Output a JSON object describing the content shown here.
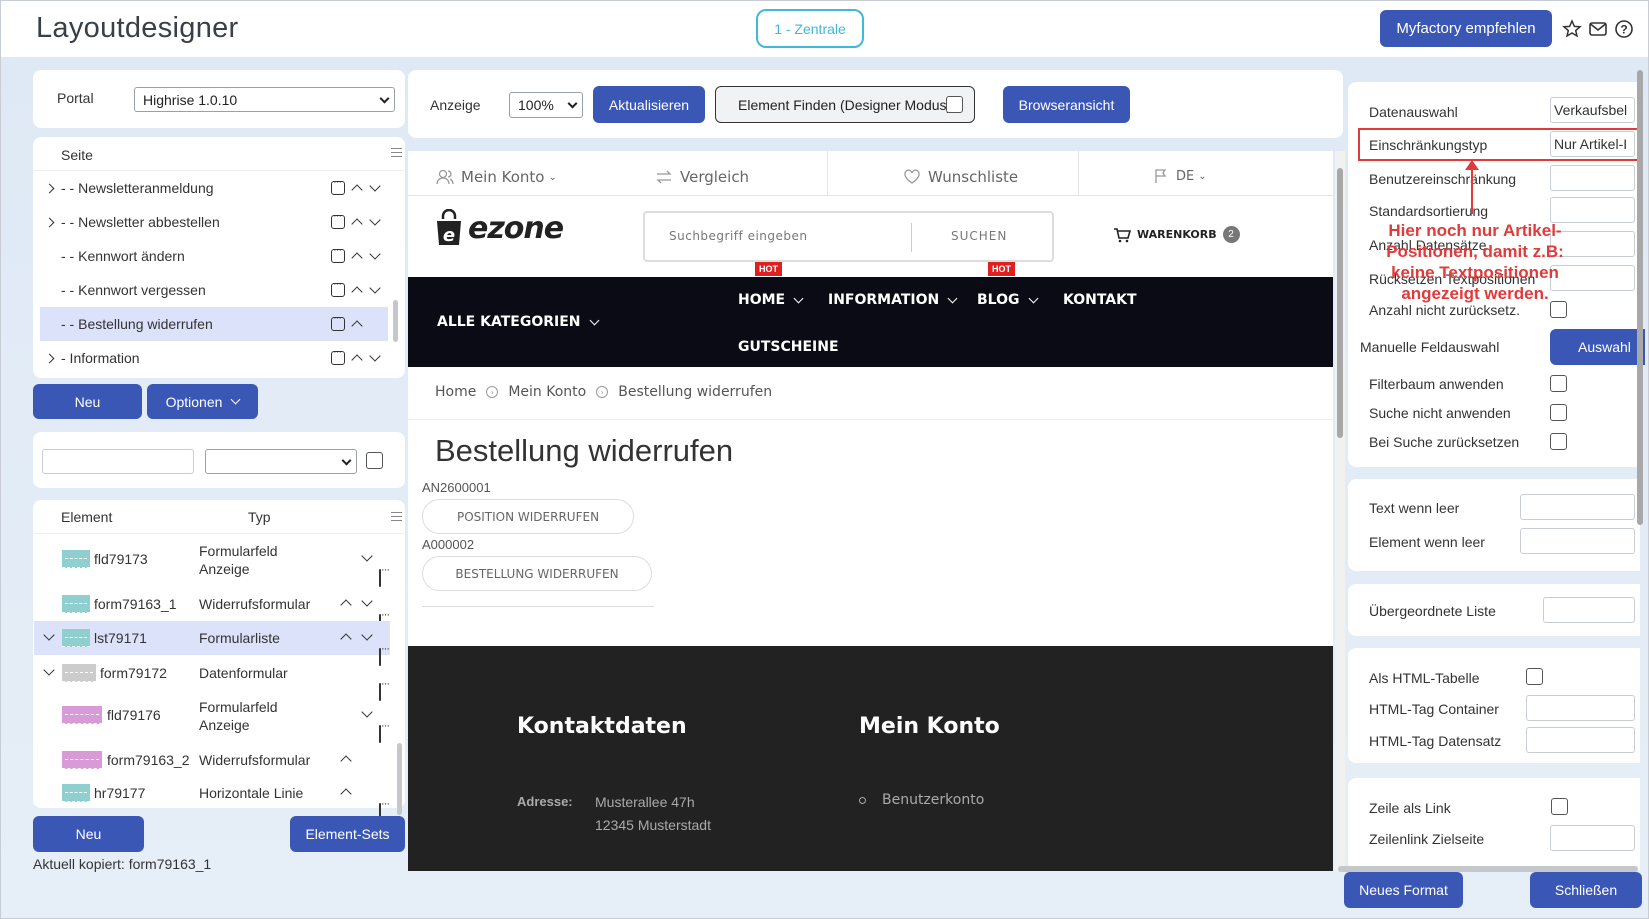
{
  "app": {
    "title": "Layoutdesigner",
    "location": "1 - Zentrale",
    "recommend_label": "Myfactory empfehlen"
  },
  "left": {
    "portal_label": "Portal",
    "portal_value": "Highrise 1.0.10",
    "page_header": "Seite",
    "pages": [
      {
        "label": "- - Newsletteranmeldung"
      },
      {
        "label": "- - Newsletter abbestellen"
      },
      {
        "label": "- - Kennwort ändern"
      },
      {
        "label": "- - Kennwort vergessen"
      },
      {
        "label": "- - Bestellung widerrufen"
      },
      {
        "label": "- Information"
      }
    ],
    "btn_new": "Neu",
    "btn_options": "Optionen",
    "element_header": "Element",
    "type_header": "Typ",
    "elements": [
      {
        "name": "fld79173",
        "type": "Formularfeld Anzeige",
        "color": "#8fcfcf"
      },
      {
        "name": "form79163_1",
        "type": "Widerrufsformular",
        "color": "#8fcfcf"
      },
      {
        "name": "lst79171",
        "type": "Formularliste",
        "color": "#8fcfcf"
      },
      {
        "name": "form79172",
        "type": "Datenformular",
        "color": "#cccccc"
      },
      {
        "name": "fld79176",
        "type": "Formularfeld Anzeige",
        "color": "#d89bd8"
      },
      {
        "name": "form79163_2",
        "type": "Widerrufsformular",
        "color": "#d89bd8"
      },
      {
        "name": "hr79177",
        "type": "Horizontale Linie",
        "color": "#8fcfcf"
      }
    ],
    "btn_new2": "Neu",
    "btn_sets": "Element-Sets",
    "copied": "Aktuell kopiert: form79163_1"
  },
  "toolbar": {
    "display_label": "Anzeige",
    "zoom": "100%",
    "refresh": "Aktualisieren",
    "find": "Element Finden (Designer Modus)",
    "browser": "Browseransicht"
  },
  "shop": {
    "account": "Mein Konto",
    "compare": "Vergleich",
    "wishlist": "Wunschliste",
    "lang": "DE",
    "logo": "ezone",
    "search_placeholder": "Suchbegriff eingeben",
    "search_btn": "SUCHEN",
    "cart": "WARENKORB",
    "cart_count": "2",
    "all_categories": "ALLE KATEGORIEN",
    "nav": [
      "HOME",
      "INFORMATION",
      "BLOG",
      "KONTAKT"
    ],
    "nav2": "GUTSCHEINE",
    "hot": "HOT",
    "breadcrumb": [
      "Home",
      "Mein Konto",
      "Bestellung widerrufen"
    ],
    "page_title": "Bestellung widerrufen",
    "id1": "AN2600001",
    "btn1": "POSITION WIDERRUFEN",
    "id2": "A000002",
    "btn2": "BESTELLUNG WIDERRUFEN",
    "footer_contact": "Kontaktdaten",
    "footer_account": "Mein Konto",
    "address_label": "Adresse:",
    "address_line1": "Musterallee 47h",
    "address_line2": "12345 Musterstadt",
    "footer_link": "Benutzerkonto"
  },
  "right": {
    "datenauswahl": "Datenauswahl",
    "datenauswahl_value": "Verkaufsbel",
    "einschraenkungstyp": "Einschränkungstyp",
    "einschraenkungstyp_value": "Nur Artikel-I",
    "benutzereinschraenkung": "Benutzereinschränkung",
    "standardsortierung": "Standardsortierung",
    "anzahl_datensaetze": "Anzahl Datensätze",
    "ruecksetzen": "Rücksetzen Textpositionen",
    "anzahl_nicht": "Anzahl nicht zurücksetz.",
    "manuelle": "Manuelle Feldauswahl",
    "auswahl_btn": "Auswahl",
    "filterbaum": "Filterbaum anwenden",
    "suche_nicht": "Suche nicht anwenden",
    "bei_suche": "Bei Suche zurücksetzen",
    "text_leer": "Text wenn leer",
    "element_leer": "Element wenn leer",
    "uebergeordnete": "Übergeordnete Liste",
    "als_html": "Als HTML-Tabelle",
    "html_container": "HTML-Tag Container",
    "html_datensatz": "HTML-Tag Datensatz",
    "zeile_link": "Zeile als Link",
    "zeilenlink": "Zeilenlink Zielseite",
    "btn_new_format": "Neues Format",
    "btn_close": "Schließen"
  },
  "annotation": {
    "text_line1": "Hier noch nur Artikel-",
    "text_line2": "Positionen, damit z.B:",
    "text_line3": "keine Textpositionen",
    "text_line4": "angezeigt werden.",
    "color": "#e03a3a"
  }
}
